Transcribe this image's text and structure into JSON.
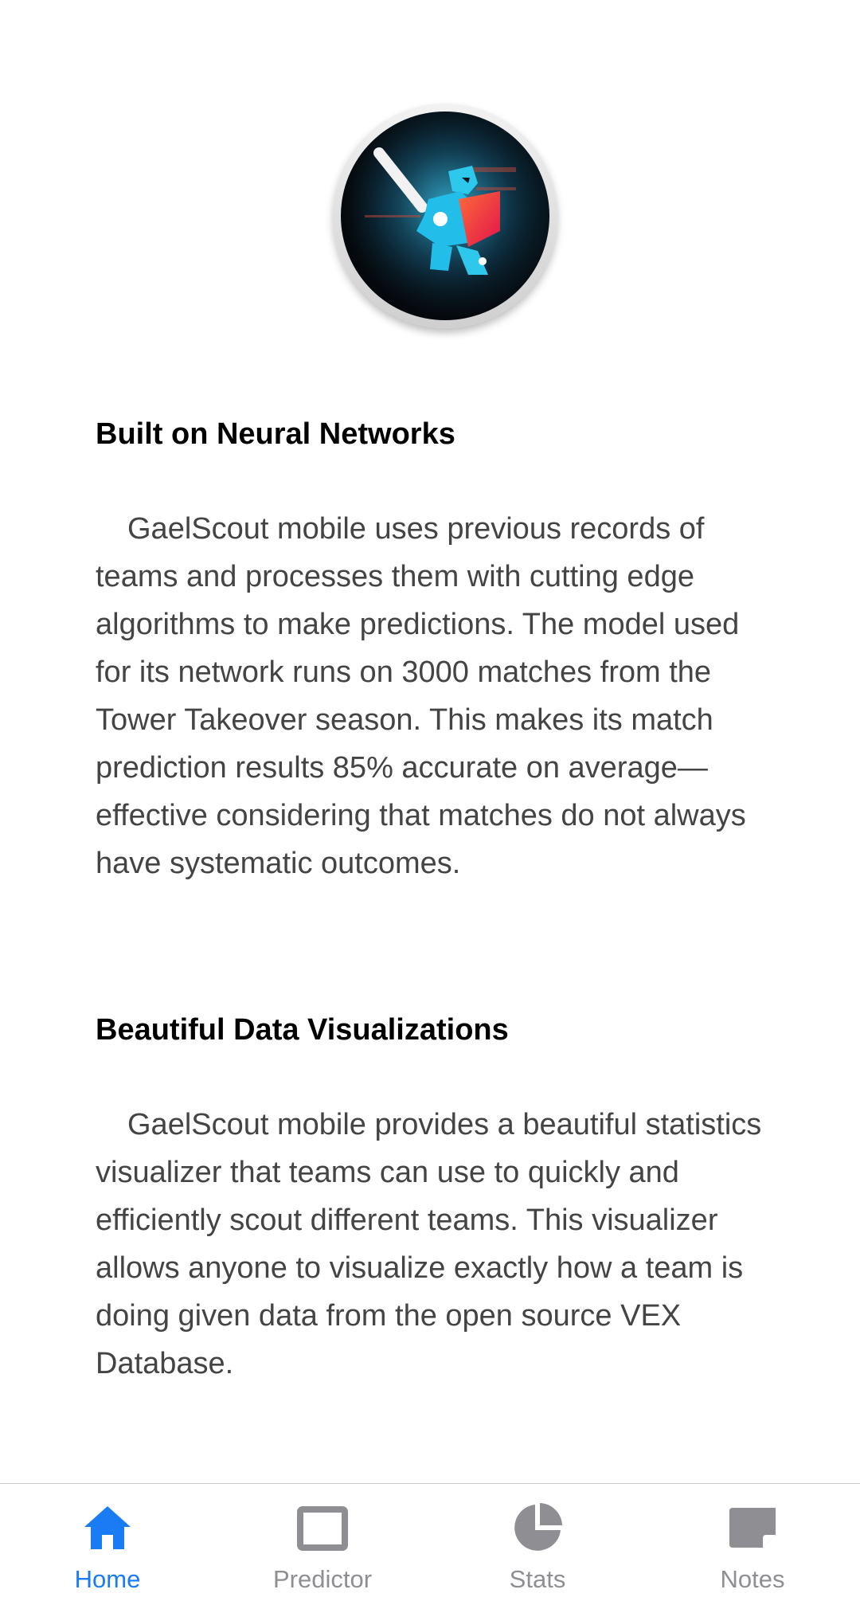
{
  "colors": {
    "accent": "#1a7cf5",
    "inactive": "#8e8e93",
    "title": "#000000",
    "body_text": "#444444"
  },
  "logo": {
    "icon": "gael-knight-logo"
  },
  "sections": [
    {
      "title": "Built on Neural Networks",
      "body": "GaelScout mobile uses previous records of teams and processes them with cutting edge algorithms to make predictions. The model used for its network runs on 3000 matches from the Tower Takeover season. This makes its match prediction results 85% accurate on average—effective considering that matches do not always have systematic outcomes."
    },
    {
      "title": "Beautiful Data Visualizations",
      "body": "GaelScout mobile provides a beautiful statistics visualizer that teams can use to quickly and efficiently scout different teams. This visualizer allows anyone to visualize exactly how a team is doing given data from the open source VEX Database."
    }
  ],
  "tabbar": {
    "tabs": [
      {
        "label": "Home",
        "icon": "home-icon",
        "active": true
      },
      {
        "label": "Predictor",
        "icon": "square-icon",
        "active": false
      },
      {
        "label": "Stats",
        "icon": "pie-chart-icon",
        "active": false
      },
      {
        "label": "Notes",
        "icon": "note-icon",
        "active": false
      }
    ]
  }
}
